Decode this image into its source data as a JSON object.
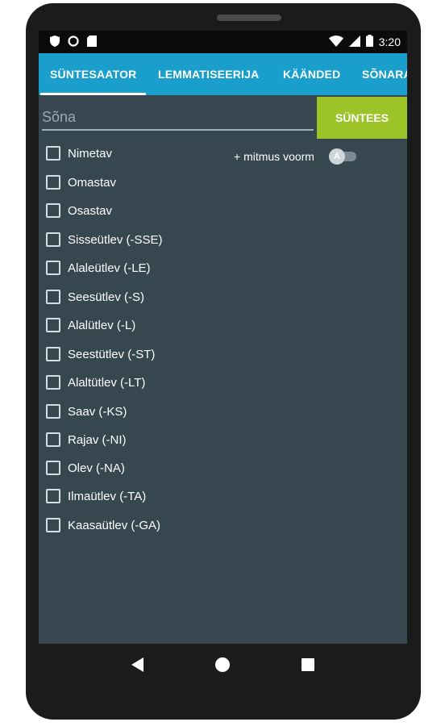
{
  "status_bar": {
    "time": "3:20",
    "left_icons": [
      "shield-icon",
      "sync-icon",
      "sd-card-icon"
    ],
    "right_icons": [
      "wifi-icon",
      "signal-icon",
      "battery-icon"
    ]
  },
  "tabs": [
    {
      "label": "SÜNTESAATOR",
      "active": true
    },
    {
      "label": "LEMMATISEERIJA",
      "active": false
    },
    {
      "label": "KÄÄNDED",
      "active": false
    },
    {
      "label": "SÕNARA",
      "active": false
    }
  ],
  "word_input": {
    "placeholder": "Sõna",
    "value": ""
  },
  "synthesize_button": "SÜNTEES",
  "cases": [
    {
      "label": "Nimetav",
      "checked": false
    },
    {
      "label": "Omastav",
      "checked": false
    },
    {
      "label": "Osastav",
      "checked": false
    },
    {
      "label": "Sisseütlev (-SSE)",
      "checked": false
    },
    {
      "label": "Alaleütlev (-LE)",
      "checked": false
    },
    {
      "label": "Seesütlev (-S)",
      "checked": false
    },
    {
      "label": "Alalütlev (-L)",
      "checked": false
    },
    {
      "label": "Seestütlev (-ST)",
      "checked": false
    },
    {
      "label": "Alaltütlev (-LT)",
      "checked": false
    },
    {
      "label": "Saav (-KS)",
      "checked": false
    },
    {
      "label": "Rajav (-NI)",
      "checked": false
    },
    {
      "label": "Olev (-NA)",
      "checked": false
    },
    {
      "label": "Ilmaütlev (-TA)",
      "checked": false
    },
    {
      "label": "Kaasaütlev (-GA)",
      "checked": false
    }
  ],
  "plural_toggle": {
    "label": "+ mitmus voorm",
    "thumb_letter": "A",
    "on": false
  },
  "nav_bar": [
    "back-icon",
    "home-icon",
    "recents-icon"
  ],
  "colors": {
    "tab_bar": "#1a9fcc",
    "background": "#37474f",
    "synth_button": "#9cc429"
  }
}
